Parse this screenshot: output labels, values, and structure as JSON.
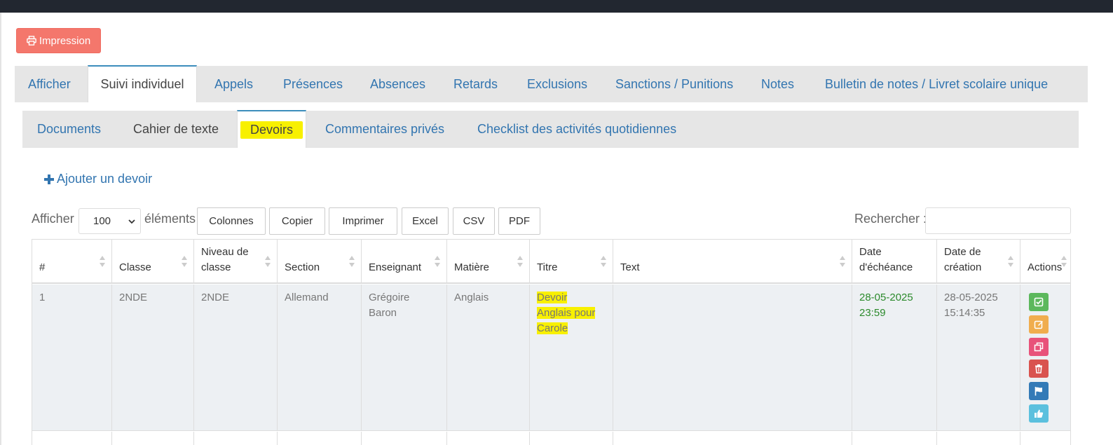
{
  "toolbar": {
    "print_label": "Impression"
  },
  "main_tabs": [
    {
      "label": "Afficher"
    },
    {
      "label": "Suivi individuel"
    },
    {
      "label": "Appels"
    },
    {
      "label": "Présences"
    },
    {
      "label": "Absences"
    },
    {
      "label": "Retards"
    },
    {
      "label": "Exclusions"
    },
    {
      "label": "Sanctions / Punitions"
    },
    {
      "label": "Notes"
    },
    {
      "label": "Bulletin de notes / Livret scolaire unique"
    }
  ],
  "sub_tabs": [
    {
      "label": "Documents"
    },
    {
      "label": "Cahier de texte"
    },
    {
      "label": "Devoirs"
    },
    {
      "label": "Commentaires privés"
    },
    {
      "label": "Checklist des activités quotidiennes"
    }
  ],
  "add_homework_label": "Ajouter un devoir",
  "table_controls": {
    "show_label": "Afficher",
    "page_size": "100",
    "elements_label": "éléments",
    "buttons": [
      "Colonnes",
      "Copier",
      "Imprimer",
      "Excel",
      "CSV",
      "PDF"
    ],
    "search_label": "Rechercher :"
  },
  "table": {
    "columns": [
      "#",
      "Classe",
      "Niveau de classe",
      "Section",
      "Enseignant",
      "Matière",
      "Titre",
      "Text",
      "Date d'échéance",
      "Date de création",
      "Actions"
    ],
    "rows": [
      {
        "num": "1",
        "classe": "2NDE",
        "niveau": "2NDE",
        "section": "Allemand",
        "enseignant": "Grégoire Baron",
        "matiere": "Anglais",
        "titre": "Devoir Anglais pour Carole",
        "text": "",
        "echeance": "28-05-2025 23:59",
        "creation": "28-05-2025 15:14:35"
      }
    ]
  },
  "colors": {
    "print_button": "#f4776c",
    "link": "#3275b0",
    "highlight": "#f8f000",
    "due_date": "#2c8a2c",
    "action_validate": "#5cb85c",
    "action_edit": "#f0ad4e",
    "action_copy": "#e8527a",
    "action_delete": "#d9534f",
    "action_flag": "#337ab7",
    "action_like": "#5bc0de"
  },
  "icons": {
    "print": "print-icon",
    "add": "plus-icon",
    "validate": "check-square-icon",
    "edit": "pencil-icon",
    "copy": "copy-icon",
    "delete": "trash-icon",
    "flag": "flag-icon",
    "like": "thumbs-up-icon"
  }
}
